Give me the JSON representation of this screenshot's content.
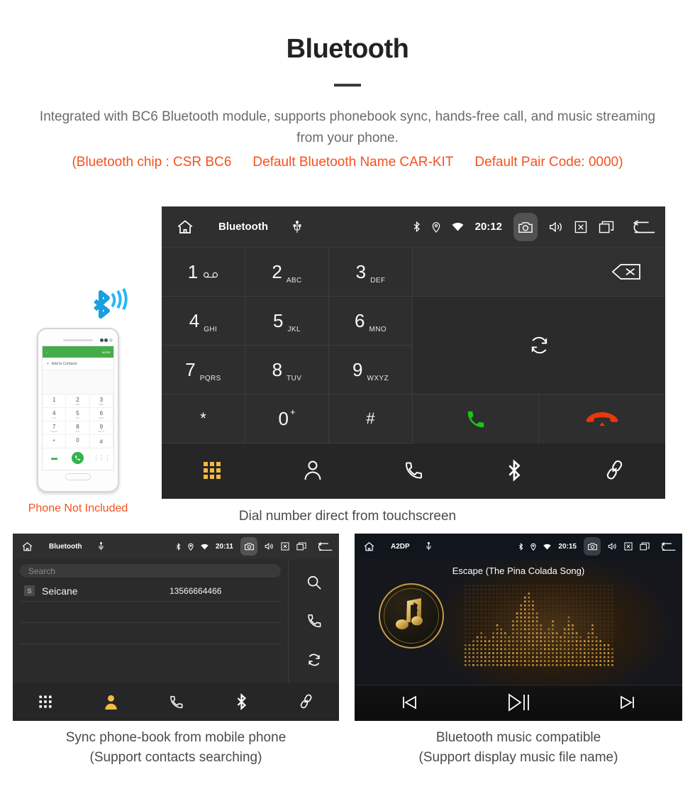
{
  "header": {
    "title": "Bluetooth",
    "intro": "Integrated with BC6 Bluetooth module, supports phonebook sync, hands-free call, and music streaming from your phone.",
    "spec_chip": "(Bluetooth chip : CSR BC6",
    "spec_name": "Default Bluetooth Name CAR-KIT",
    "spec_pair": "Default Pair Code: 0000)",
    "accent_color": "#f4511e",
    "body_color": "#6b6b6b"
  },
  "phone_mock": {
    "appbar_more": "MORE",
    "add_to_contacts": "Add to Contacts",
    "keys": [
      {
        "num": "1",
        "sub": "∞"
      },
      {
        "num": "2",
        "sub": "ABC"
      },
      {
        "num": "3",
        "sub": "DEF"
      },
      {
        "num": "4",
        "sub": "GHI"
      },
      {
        "num": "5",
        "sub": "JKL"
      },
      {
        "num": "6",
        "sub": "MNO"
      },
      {
        "num": "7",
        "sub": "PQRS"
      },
      {
        "num": "8",
        "sub": "TUV"
      },
      {
        "num": "9",
        "sub": "WXYZ"
      },
      {
        "num": "*",
        "sub": ""
      },
      {
        "num": "0",
        "sub": "+"
      },
      {
        "num": "#",
        "sub": ""
      }
    ],
    "not_included_label": "Phone Not Included"
  },
  "dialer": {
    "statusbar": {
      "title": "Bluetooth",
      "time": "20:12",
      "icons": [
        "home-icon",
        "usb-icon",
        "bluetooth-icon",
        "location-icon",
        "wifi-icon",
        "camera-icon",
        "volume-icon",
        "close-box-icon",
        "recents-icon",
        "back-icon"
      ]
    },
    "keys": [
      {
        "num": "1",
        "sub": "voicemail",
        "type": "voicemail"
      },
      {
        "num": "2",
        "sub": "ABC",
        "type": "letters"
      },
      {
        "num": "3",
        "sub": "DEF",
        "type": "letters"
      },
      {
        "num": "4",
        "sub": "GHI",
        "type": "letters"
      },
      {
        "num": "5",
        "sub": "JKL",
        "type": "letters"
      },
      {
        "num": "6",
        "sub": "MNO",
        "type": "letters"
      },
      {
        "num": "7",
        "sub": "PQRS",
        "type": "letters"
      },
      {
        "num": "8",
        "sub": "TUV",
        "type": "letters"
      },
      {
        "num": "9",
        "sub": "WXYZ",
        "type": "letters"
      },
      {
        "num": "*",
        "sub": "",
        "type": "plain"
      },
      {
        "num": "0",
        "sub": "+",
        "type": "plus"
      },
      {
        "num": "#",
        "sub": "",
        "type": "plain"
      }
    ],
    "actions": {
      "backspace": "backspace-icon",
      "sync": "sync-icon",
      "call": "call-icon",
      "hangup": "hangup-icon",
      "call_color": "#17c617",
      "hangup_color": "#e8380d"
    },
    "tabs": [
      {
        "name": "keypad",
        "icon": "keypad-icon",
        "active": true
      },
      {
        "name": "contacts",
        "icon": "person-icon",
        "active": false
      },
      {
        "name": "call-log",
        "icon": "phone-icon",
        "active": false
      },
      {
        "name": "bluetooth",
        "icon": "bluetooth-icon",
        "active": false
      },
      {
        "name": "pair",
        "icon": "link-icon",
        "active": false
      }
    ],
    "active_color": "#f5b942",
    "caption": "Dial number direct from touchscreen"
  },
  "contacts": {
    "statusbar": {
      "title": "Bluetooth",
      "time": "20:11"
    },
    "search_placeholder": "Search",
    "rows": [
      {
        "initial": "S",
        "name": "Seicane",
        "number": "13566664466"
      }
    ],
    "side_icons": [
      "search-icon",
      "phone-icon",
      "sync-icon"
    ],
    "tabs": [
      {
        "name": "keypad",
        "icon": "keypad-icon",
        "active": false
      },
      {
        "name": "contacts",
        "icon": "person-icon",
        "active": true
      },
      {
        "name": "call-log",
        "icon": "phone-icon",
        "active": false
      },
      {
        "name": "bluetooth",
        "icon": "bluetooth-icon",
        "active": false
      },
      {
        "name": "pair",
        "icon": "link-icon",
        "active": false
      }
    ],
    "caption_line1": "Sync phone-book from mobile phone",
    "caption_line2": "(Support contacts searching)"
  },
  "music": {
    "statusbar": {
      "title": "A2DP",
      "time": "20:15"
    },
    "song_title": "Escape (The Pina Colada Song)",
    "controls": [
      {
        "name": "previous",
        "icon": "skip-previous-icon"
      },
      {
        "name": "play-pause",
        "icon": "play-pause-icon"
      },
      {
        "name": "next",
        "icon": "skip-next-icon"
      }
    ],
    "accent_color": "#c79b45",
    "caption_line1": "Bluetooth music compatible",
    "caption_line2": "(Support display music file name)"
  }
}
